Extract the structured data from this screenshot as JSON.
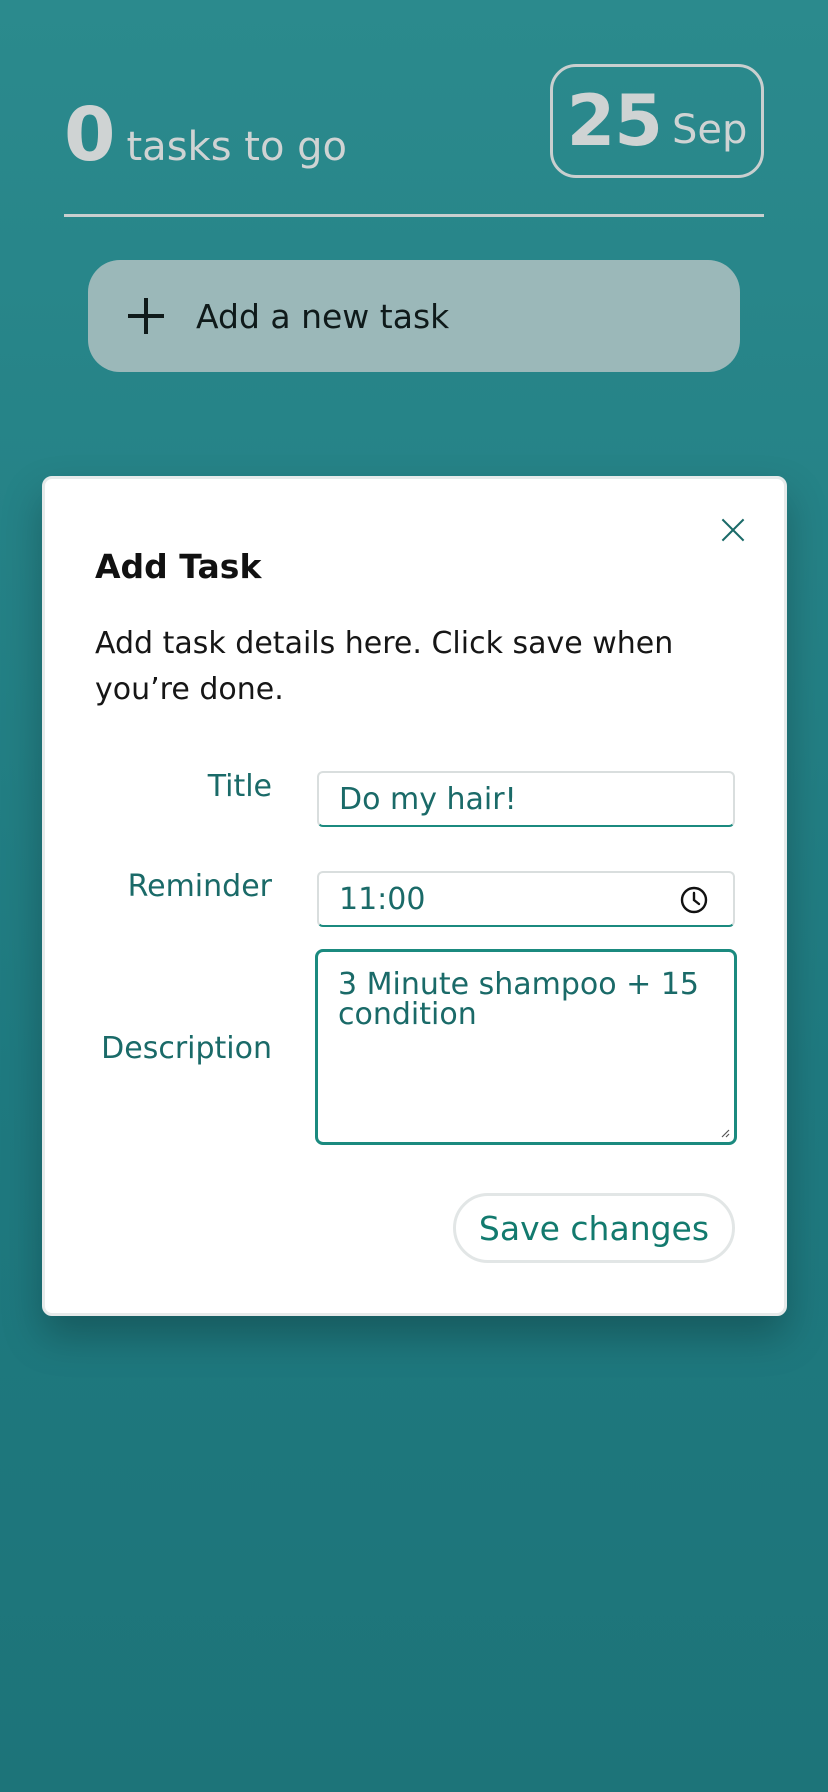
{
  "header": {
    "count": "0",
    "count_label": "tasks to go",
    "date_day": "25",
    "date_month": "Sep"
  },
  "add_task_bar": {
    "icon": "plus-icon",
    "label": "Add a new task"
  },
  "dialog": {
    "title": "Add Task",
    "description": "Add task details here. Click save when you’re done.",
    "close_icon": "close-icon",
    "fields": {
      "title": {
        "label": "Title",
        "value": "Do my hair!"
      },
      "reminder": {
        "label": "Reminder",
        "value": "11:00",
        "icon": "clock-icon"
      },
      "description": {
        "label": "Description",
        "value": "3 Minute shampoo + 15 condition"
      }
    },
    "save_label": "Save changes"
  },
  "colors": {
    "background": "#237f84",
    "add_bar": "#9bb8b9",
    "accent": "#1b8a7f",
    "label_text": "#1a6a68"
  }
}
